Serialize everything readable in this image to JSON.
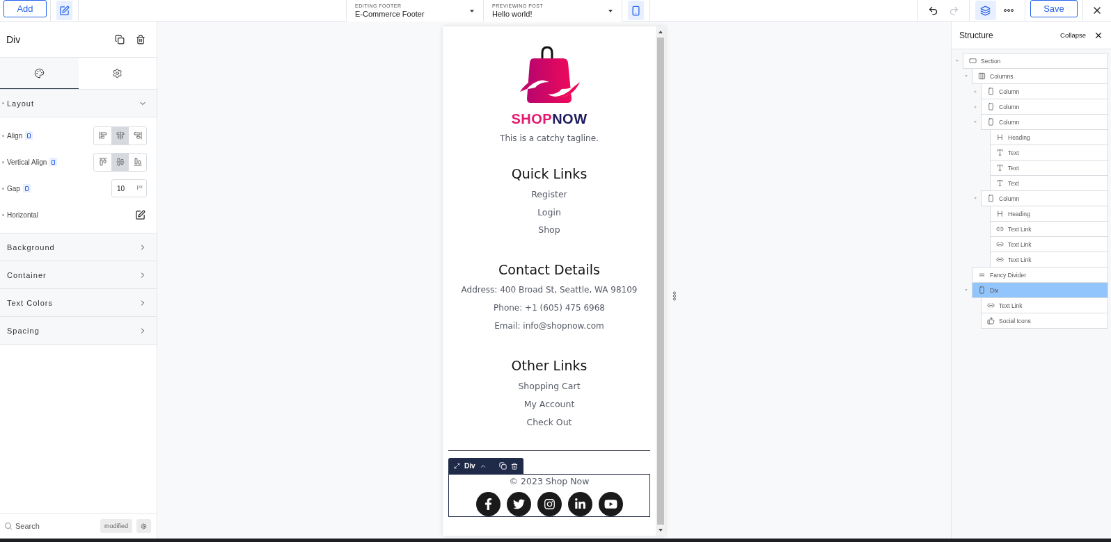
{
  "topbar": {
    "add_button": "Add",
    "editing": {
      "label": "EDITING FOOTER",
      "value": "E-Commerce Footer"
    },
    "previewing": {
      "label": "PREVIEWING POST",
      "value": "Hello world!"
    },
    "mobile_selected": true,
    "redo_disabled": true,
    "structure_selected": true,
    "save_button": "Save"
  },
  "inspector": {
    "title": "Div",
    "tabs": [
      {
        "kind": "style",
        "selected": true
      },
      {
        "kind": "settings",
        "selected": false
      }
    ],
    "layout": {
      "title": "Layout",
      "expanded": true,
      "align": {
        "label": "Align",
        "options": [
          {
            "kind": "start",
            "selected": false
          },
          {
            "kind": "center",
            "selected": true
          },
          {
            "kind": "end",
            "selected": false
          }
        ]
      },
      "vertical_align": {
        "label": "Vertical Align",
        "options": [
          {
            "kind": "start",
            "selected": false
          },
          {
            "kind": "center",
            "selected": true
          },
          {
            "kind": "end",
            "selected": false
          }
        ]
      },
      "gap": {
        "label": "Gap",
        "value": "10",
        "unit": "px"
      },
      "direction": {
        "label": "Horizontal"
      }
    },
    "sections": [
      {
        "title": "Background",
        "expanded": false
      },
      {
        "title": "Container",
        "expanded": false
      },
      {
        "title": "Text Colors",
        "expanded": false
      },
      {
        "title": "Spacing",
        "expanded": false
      }
    ],
    "search": {
      "placeholder": "Search"
    },
    "modified_button": "modified"
  },
  "preview": {
    "brand": {
      "first": "SHOP",
      "second": "NOW"
    },
    "tagline": "This is a catchy tagline.",
    "groups": [
      {
        "heading": "Quick Links",
        "kind": "links",
        "items": [
          "Register",
          "Login",
          "Shop"
        ]
      },
      {
        "heading": "Contact Details",
        "kind": "text",
        "items": [
          "Address: 400 Broad St, Seattle, WA 98109",
          "Phone: +1 (605) 475 6968",
          "Email: info@shopnow.com"
        ]
      },
      {
        "heading": "Other Links",
        "kind": "links",
        "items": [
          "Shopping Cart",
          "My Account",
          "Check Out"
        ]
      }
    ],
    "selection_label": "Div",
    "copyright": "© 2023 Shop Now",
    "social": [
      {
        "kind": "facebook"
      },
      {
        "kind": "twitter"
      },
      {
        "kind": "instagram"
      },
      {
        "kind": "linkedin"
      },
      {
        "kind": "youtube"
      }
    ]
  },
  "structure": {
    "title": "Structure",
    "collapse": "Collapse",
    "items": [
      {
        "kind": "section",
        "label": "Section",
        "expanded": true,
        "selected": false,
        "children": [
          {
            "kind": "columns",
            "label": "Columns",
            "expanded": true,
            "selected": false,
            "children": [
              {
                "kind": "column",
                "label": "Column",
                "expanded": false,
                "selected": false
              },
              {
                "kind": "column",
                "label": "Column",
                "expanded": false,
                "selected": false
              },
              {
                "kind": "column",
                "label": "Column",
                "expanded": true,
                "selected": false,
                "children": [
                  {
                    "kind": "heading",
                    "label": "Heading",
                    "selected": false
                  },
                  {
                    "kind": "text",
                    "label": "Text",
                    "selected": false
                  },
                  {
                    "kind": "text",
                    "label": "Text",
                    "selected": false
                  },
                  {
                    "kind": "text",
                    "label": "Text",
                    "selected": false
                  }
                ]
              },
              {
                "kind": "column",
                "label": "Column",
                "expanded": true,
                "selected": false,
                "children": [
                  {
                    "kind": "heading",
                    "label": "Heading",
                    "selected": false
                  },
                  {
                    "kind": "link",
                    "label": "Text Link",
                    "selected": false
                  },
                  {
                    "kind": "link",
                    "label": "Text Link",
                    "selected": false
                  },
                  {
                    "kind": "link",
                    "label": "Text Link",
                    "selected": false
                  }
                ]
              }
            ]
          },
          {
            "kind": "divider",
            "label": "Fancy Divider",
            "selected": false
          },
          {
            "kind": "div",
            "label": "Div",
            "expanded": true,
            "selected": true,
            "children": [
              {
                "kind": "link",
                "label": "Text Link",
                "selected": false
              },
              {
                "kind": "social",
                "label": "Social Icons",
                "selected": false
              }
            ]
          }
        ]
      }
    ]
  }
}
